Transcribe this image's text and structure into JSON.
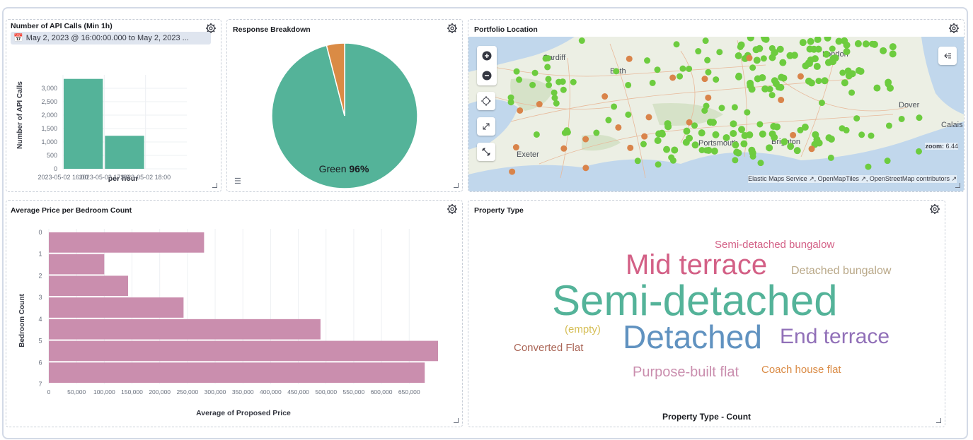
{
  "panels": {
    "api_calls": {
      "title": "Number of API Calls (Min 1h)",
      "date_range": "May 2, 2023 @ 16:00:00.000 to May 2, 2023 ...",
      "xlabel": "per hour",
      "ylabel": "Number of API Calls"
    },
    "response": {
      "title": "Response Breakdown",
      "slice_label": "Green",
      "slice_pct": "96%"
    },
    "portfolio": {
      "title": "Portfolio Location",
      "zoom_label": "zoom:",
      "zoom_value": "6.44",
      "attribution": "Elastic Maps Service ↗, OpenMapTiles ↗, OpenStreetMap contributors ↗",
      "places": [
        "Cardiff",
        "Bath",
        "London",
        "Dover",
        "Calais",
        "Exeter",
        "Portsmouth",
        "Brighton"
      ]
    },
    "avg_price": {
      "title": "Average Price per Bedroom Count",
      "xlabel": "Average of Proposed Price",
      "ylabel": "Bedroom Count"
    },
    "property_type": {
      "title": "Property Type",
      "footer": "Property Type - Count",
      "words": [
        {
          "text": "Semi-detached bungalow",
          "color": "#d36086"
        },
        {
          "text": "Mid terrace",
          "color": "#d36086"
        },
        {
          "text": "Detached bungalow",
          "color": "#b9a888"
        },
        {
          "text": "Semi-detached",
          "color": "#54b399"
        },
        {
          "text": "(empty)",
          "color": "#d6bf57"
        },
        {
          "text": "Detached",
          "color": "#6092c0"
        },
        {
          "text": "End terrace",
          "color": "#9170b8"
        },
        {
          "text": "Converted Flat",
          "color": "#aa6556"
        },
        {
          "text": "Purpose-built flat",
          "color": "#ca8eae"
        },
        {
          "text": "Coach house flat",
          "color": "#da8b45"
        }
      ]
    }
  },
  "chart_data": [
    {
      "type": "bar",
      "title": "Number of API Calls (Min 1h)",
      "categories": [
        "2023-05-02 16:00",
        "2023-05-02 17:00",
        "2023-05-02 18:00"
      ],
      "values": [
        3350,
        1230,
        0
      ],
      "xlabel": "per hour",
      "ylabel": "Number of API Calls",
      "yticks": [
        "0",
        "500",
        "1,000",
        "1,500",
        "2,000",
        "2,500",
        "3,000"
      ],
      "ylim": [
        0,
        3500
      ],
      "color": "#54b399"
    },
    {
      "type": "pie",
      "title": "Response Breakdown",
      "slices": [
        {
          "label": "Green",
          "value": 96,
          "color": "#54b399"
        },
        {
          "label": "",
          "value": 4,
          "color": "#da8b45"
        }
      ]
    },
    {
      "type": "bar",
      "orientation": "horizontal",
      "title": "Average Price per Bedroom Count",
      "categories": [
        "0",
        "1",
        "2",
        "3",
        "4",
        "5",
        "6",
        "7"
      ],
      "values": [
        280000,
        100000,
        143000,
        243000,
        490000,
        702000,
        678000
      ],
      "xlabel": "Average of Proposed Price",
      "ylabel": "Bedroom Count",
      "xticks": [
        "0",
        "50,000",
        "100,000",
        "150,000",
        "200,000",
        "250,000",
        "300,000",
        "350,000",
        "400,000",
        "450,000",
        "500,000",
        "550,000",
        "600,000",
        "650,000"
      ],
      "xlim": [
        0,
        702000
      ],
      "color": "#ca8eae"
    }
  ],
  "colors": {
    "green": "#54b399",
    "orange": "#da8b45",
    "pink": "#ca8eae",
    "map_green": "#6dcc3f",
    "map_orange": "#d9844a",
    "sea": "#c1d7ec",
    "land": "#ecefe4"
  },
  "icons": {
    "gear": "gear-icon",
    "zoom_in": "plus-icon",
    "zoom_out": "minus-icon",
    "fit": "crosshair-icon",
    "fullscreen": "expand-icon",
    "tools": "wrench-icon",
    "layers": "layers-collapse-icon",
    "legend": "list-icon"
  }
}
